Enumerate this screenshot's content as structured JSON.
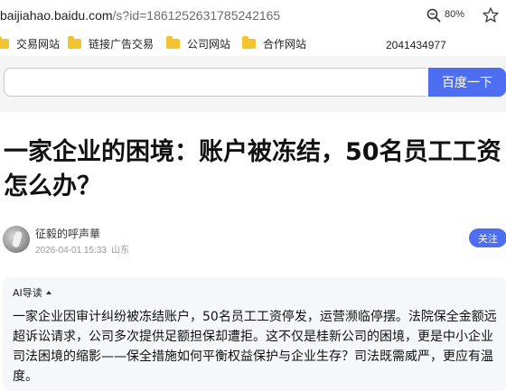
{
  "browser": {
    "url_host": "baijiahao.baidu.com",
    "url_path": "/s?id=1861252631785242165",
    "zoom": "80%"
  },
  "bookmarks": {
    "items": [
      "交易网站",
      "链接广告交易",
      "公司网站",
      "合作网站"
    ],
    "extra_number": "2041434977"
  },
  "search": {
    "input_value": "",
    "button_label": "百度一下"
  },
  "article": {
    "title": "一家企业的困境：账户被冻结，50名员工工资怎么办？",
    "author": "征毅的呼声華",
    "date": "2026-04-01 15:33",
    "location": "山东",
    "follow_label": "关注"
  },
  "ai_summary": {
    "label": "AI导读",
    "text": "一家企业因审计纠纷被冻结账户，50名员工工资停发，运营濒临停摆。法院保全金额远超诉讼请求，公司多次提供足额担保却遭拒。这不仅是桂新公司的困境，更是中小企业司法困境的缩影——保全措施如何平衡权益保护与企业生存？司法既需威严，更应有温度。"
  },
  "colors": {
    "accent": "#4e6ef2",
    "folder": "#f4c430",
    "ai_bg": "#f6f7fa"
  },
  "icons": [
    "zoom-icon",
    "star-icon",
    "folder-icon",
    "avatar",
    "caret-up-icon"
  ]
}
